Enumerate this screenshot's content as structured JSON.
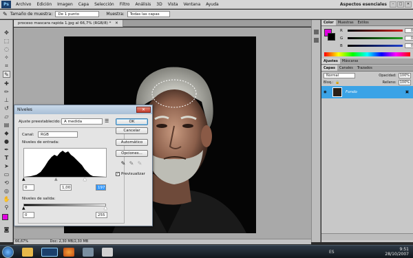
{
  "menubar": {
    "app_logo": "Ps",
    "items": [
      "Archivo",
      "Edición",
      "Imagen",
      "Capa",
      "Selección",
      "Filtro",
      "Análisis",
      "3D",
      "Vista",
      "Ventana",
      "Ayuda"
    ],
    "workspace": "Aspectos esenciales",
    "window_buttons": [
      "–",
      "□",
      "✕"
    ]
  },
  "options": {
    "sample_size_label": "Tamaño de muestra:",
    "sample_size_value": "De 1 punto",
    "sample_label": "Muestra:",
    "sample_value": "Todas las capas"
  },
  "document": {
    "tab_title": "proceso mascara rapida 1.jpg al 66,7% (RGB/8) *",
    "zoom": "66,67%",
    "doc_info": "Doc: 2,30 MB/2,30 MB"
  },
  "color_panel": {
    "tabs": [
      "Color",
      "Muestras",
      "Estilos"
    ],
    "channels": [
      {
        "letter": "R",
        "value": "0",
        "color": "#d02020"
      },
      {
        "letter": "G",
        "value": "0",
        "color": "#20a020"
      },
      {
        "letter": "B",
        "value": "0",
        "color": "#2040d0"
      }
    ]
  },
  "adjust_panel": {
    "tabs": [
      "Ajustes",
      "Máscaras"
    ]
  },
  "layers_panel": {
    "tabs": [
      "Capas",
      "Canales",
      "Trazados"
    ],
    "blend_mode": "Normal",
    "opacity_label": "Opacidad:",
    "opacity_value": "100%",
    "lock_label": "Bloq.:",
    "fill_label": "Relleno:",
    "fill_value": "100%",
    "layer_name": "Fondo"
  },
  "levels_dialog": {
    "title": "Niveles",
    "preset_label": "Ajuste preestablecido:",
    "preset_value": "A medida",
    "channel_label": "Canal:",
    "channel_value": "RGB",
    "input_label": "Niveles de entrada:",
    "input_black": "0",
    "input_gamma": "1,00",
    "input_white": "197",
    "output_label": "Niveles de salida:",
    "output_black": "0",
    "output_white": "255",
    "ok": "OK",
    "cancel": "Cancelar",
    "auto": "Automático",
    "options": "Opciones...",
    "preview_label": "Previsualizar",
    "preview_checked": true
  },
  "taskbar": {
    "language": "ES",
    "time": "9:51",
    "date": "28/10/2007"
  }
}
